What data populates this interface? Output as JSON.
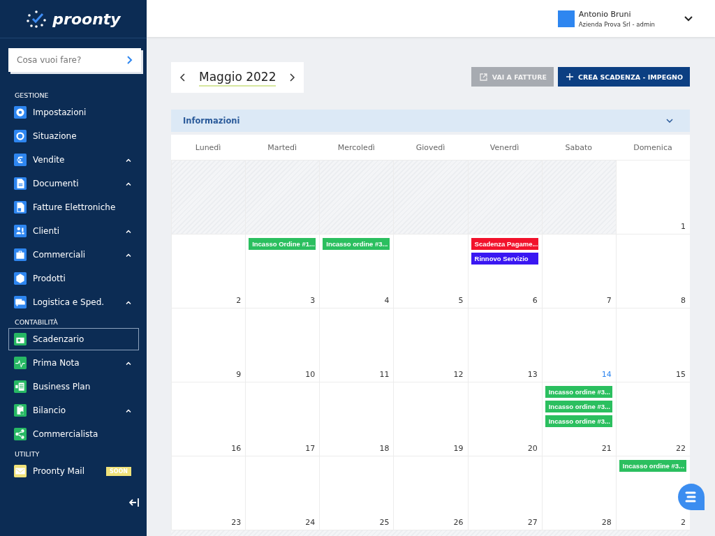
{
  "logo": {
    "text": "proonty"
  },
  "search": {
    "placeholder": "Cosa vuoi fare?"
  },
  "sidebar": {
    "sections": [
      {
        "title": "GESTIONE",
        "color": "#2e86f0",
        "items": [
          {
            "label": "Impostazioni",
            "expandable": false,
            "selected": false
          },
          {
            "label": "Situazione",
            "expandable": false,
            "selected": false
          },
          {
            "label": "Vendite",
            "expandable": true,
            "selected": false
          },
          {
            "label": "Documenti",
            "expandable": true,
            "selected": false
          },
          {
            "label": "Fatture Elettroniche",
            "expandable": false,
            "selected": false
          },
          {
            "label": "Clienti",
            "expandable": true,
            "selected": false
          },
          {
            "label": "Commerciali",
            "expandable": true,
            "selected": false
          },
          {
            "label": "Prodotti",
            "expandable": false,
            "selected": false
          },
          {
            "label": "Logistica e Sped.",
            "expandable": true,
            "selected": false
          }
        ]
      },
      {
        "title": "CONTABILITÀ",
        "color": "#27b864",
        "items": [
          {
            "label": "Scadenzario",
            "expandable": false,
            "selected": true
          },
          {
            "label": "Prima Nota",
            "expandable": true,
            "selected": false
          },
          {
            "label": "Business Plan",
            "expandable": false,
            "selected": false
          },
          {
            "label": "Bilancio",
            "expandable": true,
            "selected": false
          },
          {
            "label": "Commercialista",
            "expandable": false,
            "selected": false
          }
        ]
      },
      {
        "title": "UTILITY",
        "color": "#f0e27a",
        "items": [
          {
            "label": "Proonty Mail",
            "expandable": false,
            "selected": false,
            "badge": "SOON"
          }
        ]
      }
    ]
  },
  "user": {
    "name": "Antonio Bruni",
    "company": "Azienda Prova Srl - admin"
  },
  "month": {
    "label": "Maggio 2022"
  },
  "buttons": [
    {
      "label": "VAI A FATTURE",
      "kind": "secondary"
    },
    {
      "label": "CREA SCADENZA - IMPEGNO",
      "kind": "primary"
    }
  ],
  "info_panel": {
    "title": "Informazioni",
    "expanded": false
  },
  "calendar": {
    "weekdays": [
      "Lunedì",
      "Martedì",
      "Mercoledì",
      "Giovedì",
      "Venerdì",
      "Sabato",
      "Domenica"
    ],
    "weeks": [
      [
        {
          "in_month": false
        },
        {
          "in_month": false
        },
        {
          "in_month": false
        },
        {
          "in_month": false
        },
        {
          "in_month": false
        },
        {
          "in_month": false
        },
        {
          "day": "1",
          "in_month": true
        }
      ],
      [
        {
          "day": "2",
          "in_month": true
        },
        {
          "day": "3",
          "in_month": true,
          "events": [
            {
              "title": "Incasso Ordine #1...",
              "color": "#2bbf5f"
            }
          ]
        },
        {
          "day": "4",
          "in_month": true,
          "events": [
            {
              "title": "Incasso ordine #3...",
              "color": "#2bbf5f"
            }
          ]
        },
        {
          "day": "5",
          "in_month": true
        },
        {
          "day": "6",
          "in_month": true,
          "events": [
            {
              "title": "Scadenza Pagame...",
              "color": "#f2122b"
            },
            {
              "title": "Rinnovo Servizio",
              "color": "#3a17f2"
            }
          ]
        },
        {
          "day": "7",
          "in_month": true
        },
        {
          "day": "8",
          "in_month": true
        }
      ],
      [
        {
          "day": "9",
          "in_month": true
        },
        {
          "day": "10",
          "in_month": true
        },
        {
          "day": "11",
          "in_month": true
        },
        {
          "day": "12",
          "in_month": true
        },
        {
          "day": "13",
          "in_month": true
        },
        {
          "day": "14",
          "in_month": true,
          "today": true
        },
        {
          "day": "15",
          "in_month": true
        }
      ],
      [
        {
          "day": "16",
          "in_month": true
        },
        {
          "day": "17",
          "in_month": true
        },
        {
          "day": "18",
          "in_month": true
        },
        {
          "day": "19",
          "in_month": true
        },
        {
          "day": "20",
          "in_month": true
        },
        {
          "day": "21",
          "in_month": true,
          "events": [
            {
              "title": "Incasso ordine #3...",
              "color": "#2bbf5f"
            },
            {
              "title": "Incasso ordine #3...",
              "color": "#2bbf5f"
            },
            {
              "title": "Incasso ordine #3...",
              "color": "#2bbf5f"
            }
          ]
        },
        {
          "day": "22",
          "in_month": true
        }
      ],
      [
        {
          "day": "23",
          "in_month": true
        },
        {
          "day": "24",
          "in_month": true
        },
        {
          "day": "25",
          "in_month": true
        },
        {
          "day": "26",
          "in_month": true
        },
        {
          "day": "27",
          "in_month": true
        },
        {
          "day": "28",
          "in_month": true
        },
        {
          "day": "2",
          "in_month": true,
          "events": [
            {
              "title": "Incasso ordine #3...",
              "color": "#2bbf5f"
            }
          ]
        }
      ]
    ]
  }
}
